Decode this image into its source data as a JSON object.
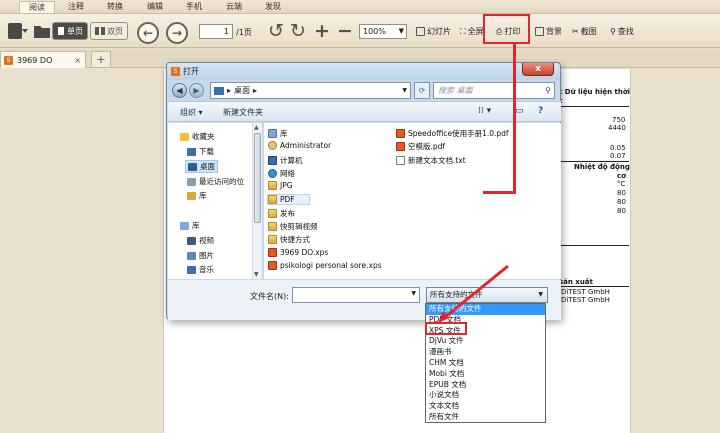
{
  "menu": {
    "tabs": [
      "阅读",
      "注释",
      "转换",
      "编辑",
      "手机",
      "云端",
      "发现"
    ],
    "active_index": 0
  },
  "toolbar": {
    "single_page_label": "单页",
    "double_page_label": "双页",
    "current_page": "1",
    "total_pages": "/1页",
    "zoom_value": "100%",
    "slideshow_label": "幻灯片",
    "fullscreen_label": "全屏",
    "print_label": "打印",
    "background_label": "背景",
    "screenshot_label": "截图",
    "find_label": "查找"
  },
  "tabs": {
    "doc_tab_label": "3969 DO",
    "doc_tab_close": "×",
    "add_tab": "+"
  },
  "document": {
    "header_line1": "t Dữ liệu hiện thời",
    "header_line2": "t",
    "val_750": "750",
    "val_4440": "4440",
    "val_005": "0.05",
    "val_007": "0.07",
    "heading_temp": "Nhiệt độ động",
    "unit_co": "cơ",
    "unit_c": "°C",
    "val_80a": "80",
    "val_80b": "80",
    "val_80c": "80",
    "mfr_label": "sản xuất",
    "mfr_1": "DiTEST GmbH",
    "mfr_2": "DiTEST GmbH"
  },
  "dialog": {
    "title": "打开",
    "close": "x",
    "address_path": "桌面",
    "search_placeholder": "搜索 桌面",
    "organize_label": "组织 ▾",
    "new_folder_label": "新建文件夹",
    "nav_items": [
      {
        "label": "收藏夹",
        "icon": "star-icon",
        "color": "#f1c232"
      },
      {
        "label": "下载",
        "icon": "download-folder-icon",
        "color": "#3f6ea4"
      },
      {
        "label": "桌面",
        "icon": "desktop-icon",
        "color": "#2f5c93"
      },
      {
        "label": "最近访问的位",
        "icon": "recent-places-icon",
        "color": "#8a9bb0"
      },
      {
        "label": "库",
        "icon": "library-icon",
        "color": "#d8a93a"
      },
      {
        "label": "库",
        "icon": "libraries-icon",
        "color": "#7ea9d6"
      },
      {
        "label": "视频",
        "icon": "video-icon",
        "color": "#425a78"
      },
      {
        "label": "图片",
        "icon": "pictures-icon",
        "color": "#5b86b8"
      },
      {
        "label": "音乐",
        "icon": "music-icon",
        "color": "#3a6fb0"
      }
    ],
    "files_col1": [
      {
        "label": "库",
        "type": "lib"
      },
      {
        "label": "Administrator",
        "type": "user"
      },
      {
        "label": "计算机",
        "type": "pc"
      },
      {
        "label": "网络",
        "type": "net"
      },
      {
        "label": "JPG",
        "type": "folder"
      },
      {
        "label": "PDF",
        "type": "folder"
      },
      {
        "label": "发布",
        "type": "folder"
      },
      {
        "label": "快剪辑视频",
        "type": "folder"
      },
      {
        "label": "快捷方式",
        "type": "folder"
      },
      {
        "label": "3969 DO.xps",
        "type": "pdf"
      },
      {
        "label": "psikologi personal sore.xps",
        "type": "pdf"
      }
    ],
    "files_col2": [
      {
        "label": "Speedoffice使用手册1.0.pdf",
        "type": "pdf"
      },
      {
        "label": "空模版.pdf",
        "type": "pdf"
      },
      {
        "label": "新建文本文档.txt",
        "type": "txt"
      }
    ],
    "filename_label": "文件名(N):",
    "filename_value": "",
    "filetype_value": "所有支持的文件"
  },
  "filetype_options": [
    "所有支持的文件",
    "PDF 文档",
    "XPS 文件",
    "DjVu 文件",
    "漫画书",
    "CHM 文档",
    "Mobi 文档",
    "EPUB 文档",
    "小说文档",
    "文本文档",
    "所有文件"
  ],
  "colors": {
    "accent_red": "#e2262b",
    "selection_blue": "#3399ff",
    "toolbar_bg": "#efe7d6"
  }
}
